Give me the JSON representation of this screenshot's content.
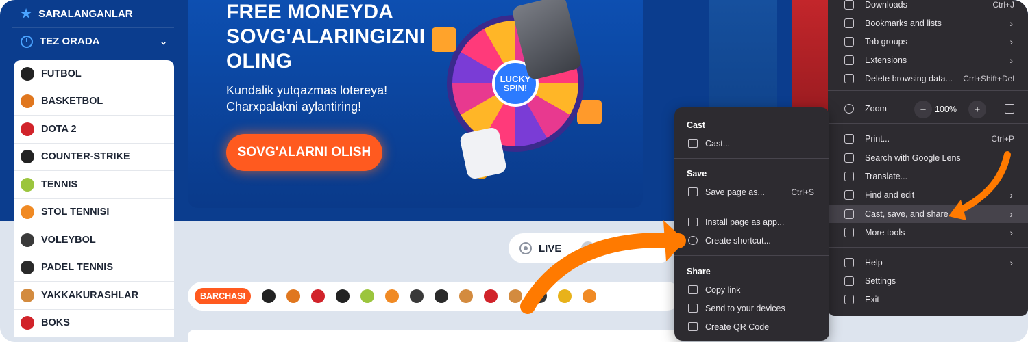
{
  "sidebar": {
    "favorites_label": "SARALANGANLAR",
    "soon_label": "TEZ ORADA",
    "sports": [
      {
        "label": "FUTBOL",
        "icon": "football-icon",
        "color": "#222222"
      },
      {
        "label": "BASKETBOL",
        "icon": "basketball-icon",
        "color": "#e0771f"
      },
      {
        "label": "DOTA 2",
        "icon": "dota2-icon",
        "color": "#d1232a"
      },
      {
        "label": "COUNTER-STRIKE",
        "icon": "counter-strike-icon",
        "color": "#222222"
      },
      {
        "label": "TENNIS",
        "icon": "tennis-icon",
        "color": "#9bc53d"
      },
      {
        "label": "STOL TENNISI",
        "icon": "table-tennis-icon",
        "color": "#f08a24"
      },
      {
        "label": "VOLEYBOL",
        "icon": "volleyball-icon",
        "color": "#3a3a3a"
      },
      {
        "label": "PADEL TENNIS",
        "icon": "padel-icon",
        "color": "#2a2a2a"
      },
      {
        "label": "YAKKAKURASHLAR",
        "icon": "martial-arts-icon",
        "color": "#d38b3f"
      },
      {
        "label": "BOKS",
        "icon": "boxing-icon",
        "color": "#d1232a"
      }
    ]
  },
  "hero": {
    "title": "FREE MONEYDA SOVG'ALARINGIZNI OLING",
    "subtitle": "Kundalik yutqazmas lotereya! Charxpalakni aylantiring!",
    "button": "SOVG'ALARNI OLISH",
    "wheel_label": "LUCKY SPIN!"
  },
  "live": {
    "label": "LIVE"
  },
  "filters": {
    "all_label": "BARCHASI",
    "icons": [
      "football-icon",
      "basketball-icon",
      "dota2-icon",
      "counter-strike-icon",
      "tennis-icon",
      "table-tennis-icon",
      "volleyball-icon",
      "padel-icon",
      "martial-arts-icon",
      "boxing-icon",
      "mma-icon",
      "hockey-icon",
      "futsal-icon",
      "other-sport-icon"
    ]
  },
  "chrome_menu": {
    "items": [
      {
        "label": "Downloads",
        "shortcut": "Ctrl+J",
        "icon": "download-icon"
      },
      {
        "label": "Bookmarks and lists",
        "arrow": "›",
        "icon": "star-icon"
      },
      {
        "label": "Tab groups",
        "arrow": "›",
        "icon": "tab-groups-icon"
      },
      {
        "label": "Extensions",
        "arrow": "›",
        "icon": "puzzle-icon"
      },
      {
        "label": "Delete browsing data...",
        "shortcut": "Ctrl+Shift+Del",
        "icon": "trash-icon"
      },
      {
        "label": "Print...",
        "shortcut": "Ctrl+P",
        "icon": "print-icon"
      },
      {
        "label": "Search with Google Lens",
        "icon": "lens-icon"
      },
      {
        "label": "Translate...",
        "icon": "translate-icon"
      },
      {
        "label": "Find and edit",
        "arrow": "›",
        "icon": "find-icon"
      },
      {
        "label": "Cast, save, and share",
        "arrow": "›",
        "icon": "cast-save-icon"
      },
      {
        "label": "More tools",
        "arrow": "›",
        "icon": "toolbox-icon"
      },
      {
        "label": "Help",
        "arrow": "›",
        "icon": "help-icon"
      },
      {
        "label": "Settings",
        "icon": "gear-icon"
      },
      {
        "label": "Exit",
        "icon": "exit-icon"
      }
    ],
    "zoom": {
      "label": "Zoom",
      "value": "100%",
      "minus": "−",
      "plus": "+"
    }
  },
  "submenu": {
    "cast_header": "Cast",
    "cast_item": "Cast...",
    "save_header": "Save",
    "save_page": "Save page as...",
    "save_shortcut": "Ctrl+S",
    "install_app": "Install page as app...",
    "create_shortcut": "Create shortcut...",
    "share_header": "Share",
    "copy_link": "Copy link",
    "send_devices": "Send to your devices",
    "qr_code": "Create QR Code"
  },
  "colors": {
    "annotation_arrow": "#ff7a00",
    "accent": "#ff5a1f",
    "site_blue": "#0b3d8e"
  }
}
